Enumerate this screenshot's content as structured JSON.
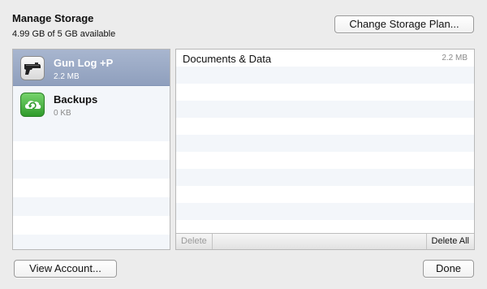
{
  "header": {
    "title": "Manage Storage",
    "subtitle": "4.99 GB of 5 GB available"
  },
  "buttons": {
    "change_plan": "Change Storage Plan...",
    "view_account": "View Account...",
    "done": "Done"
  },
  "apps": [
    {
      "name": "Gun Log +P",
      "size": "2.2 MB",
      "icon": "pistol-icon",
      "selected": true
    },
    {
      "name": "Backups",
      "size": "0 KB",
      "icon": "icloud-backup-icon",
      "selected": false
    }
  ],
  "documents": {
    "rows": [
      {
        "name": "Documents & Data",
        "size": "2.2 MB"
      }
    ],
    "delete_label": "Delete",
    "delete_all_label": "Delete All"
  },
  "colors": {
    "selection": "#97a6c3",
    "stripe": "#f3f6fa",
    "window_bg": "#ececec"
  }
}
